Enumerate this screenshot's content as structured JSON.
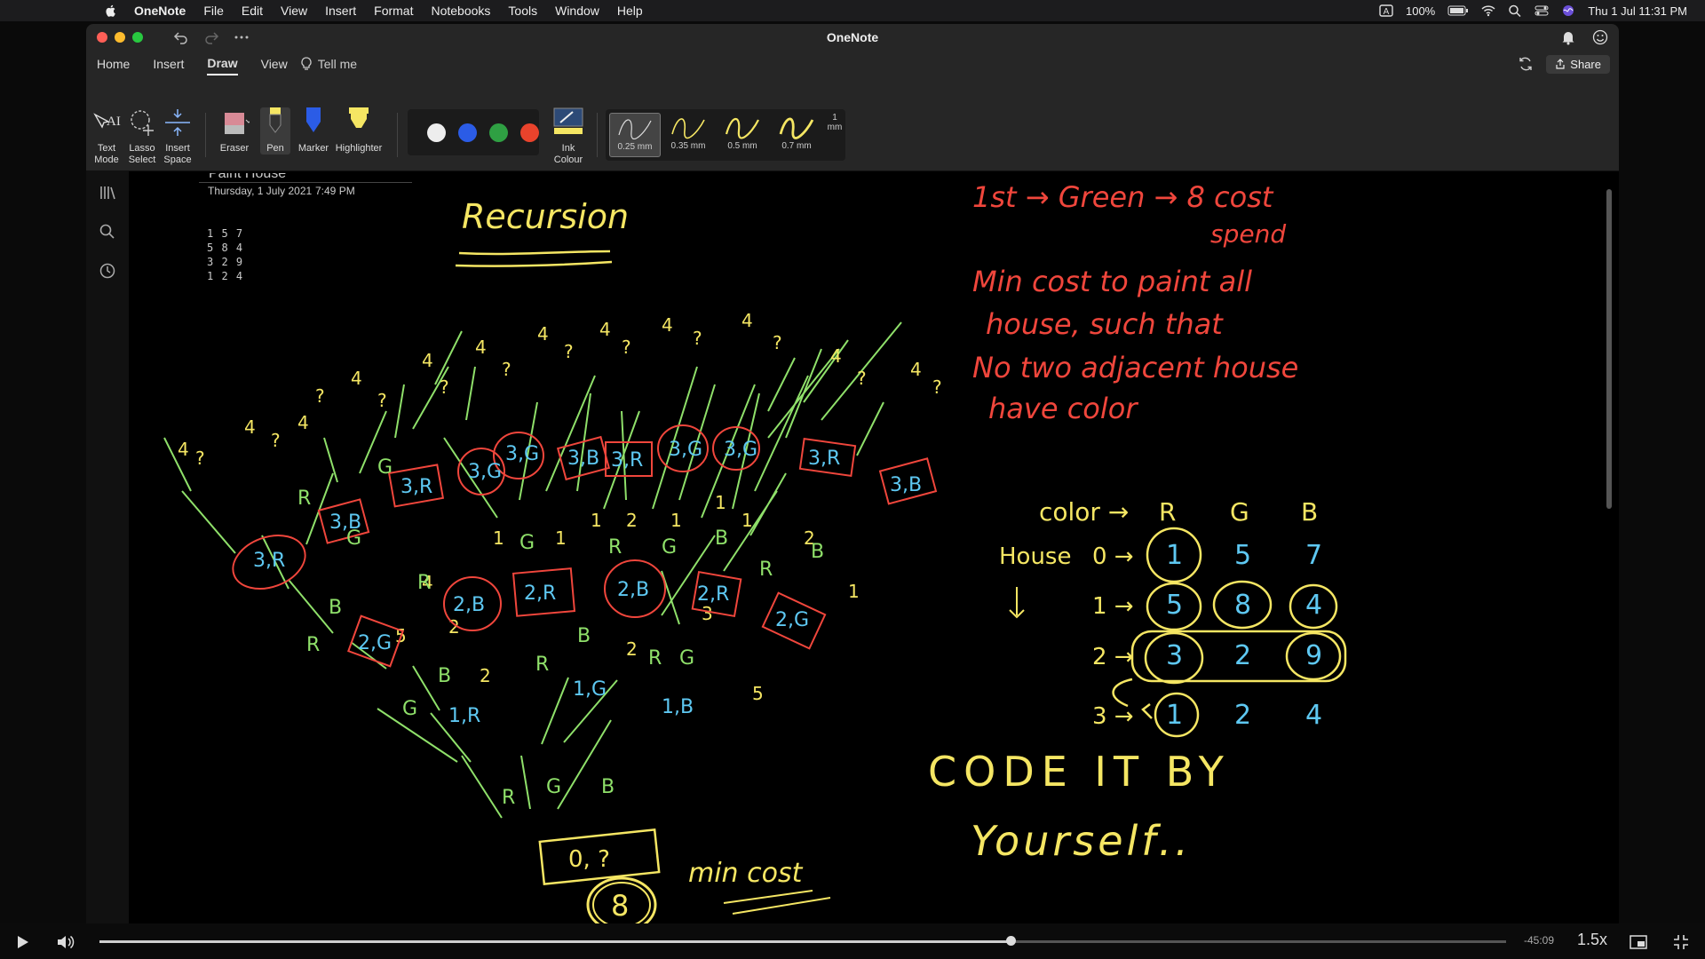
{
  "menubar": {
    "app": "OneNote",
    "items": [
      "File",
      "Edit",
      "View",
      "Insert",
      "Format",
      "Notebooks",
      "Tools",
      "Window",
      "Help"
    ],
    "battery": "100%",
    "clock": "Thu 1 Jul  11:31 PM"
  },
  "window": {
    "title": "OneNote"
  },
  "tabs": {
    "items": [
      "Home",
      "Insert",
      "Draw",
      "View"
    ],
    "active": "Draw",
    "tell_me": "Tell me",
    "share": "Share"
  },
  "ribbon": {
    "text_mode": "Text\nMode",
    "lasso": "Lasso\nSelect",
    "insert_space": "Insert\nSpace",
    "eraser": "Eraser",
    "pen": "Pen",
    "marker": "Marker",
    "highlighter": "Highlighter",
    "ink_colour": "Ink\nColour",
    "ink_colors": [
      "#ededed",
      "#2b5ce6",
      "#2fa043",
      "#e9432c"
    ],
    "pen_sizes": [
      "0.25 mm",
      "0.35 mm",
      "0.5 mm",
      "0.7 mm",
      "1 mm"
    ],
    "selected_pen_size": "0.25 mm"
  },
  "page": {
    "title_fragment": "Paint House",
    "date": "Thursday, 1 July 2021",
    "time": "7:49 PM",
    "matrix": [
      "1 5 7",
      "5 8 4",
      "3 2 9",
      "1 2 4"
    ]
  },
  "ink_notes": {
    "heading": "Recursion",
    "first": "1st → Green → 8 cost spend",
    "problem": "Min cost to paint all house, such that No two adjacent house have color",
    "table": {
      "header_label": "color →",
      "cols": [
        "R",
        "G",
        "B"
      ],
      "row_label": "House",
      "rows": [
        {
          "label": "0 →",
          "values": [
            "1",
            "5",
            "7"
          ]
        },
        {
          "label": "1 →",
          "values": [
            "5",
            "8",
            "4"
          ]
        },
        {
          "label": "2 →",
          "values": [
            "3",
            "2",
            "9"
          ]
        },
        {
          "label": "3 →",
          "values": [
            "1",
            "2",
            "4"
          ]
        }
      ]
    },
    "code_note": "CODE IT BY Yourself..",
    "min_cost_label": "min cost",
    "root_state": "0, ?",
    "root_answer": "8"
  },
  "player": {
    "time_remaining": "-45:09",
    "speed": "1.5x",
    "progress": 0.648
  },
  "colors": {
    "ink_yellow": "#f5e663",
    "ink_red": "#f0463c",
    "ink_green": "#8fe06a",
    "ink_blue": "#5ec8f2"
  }
}
